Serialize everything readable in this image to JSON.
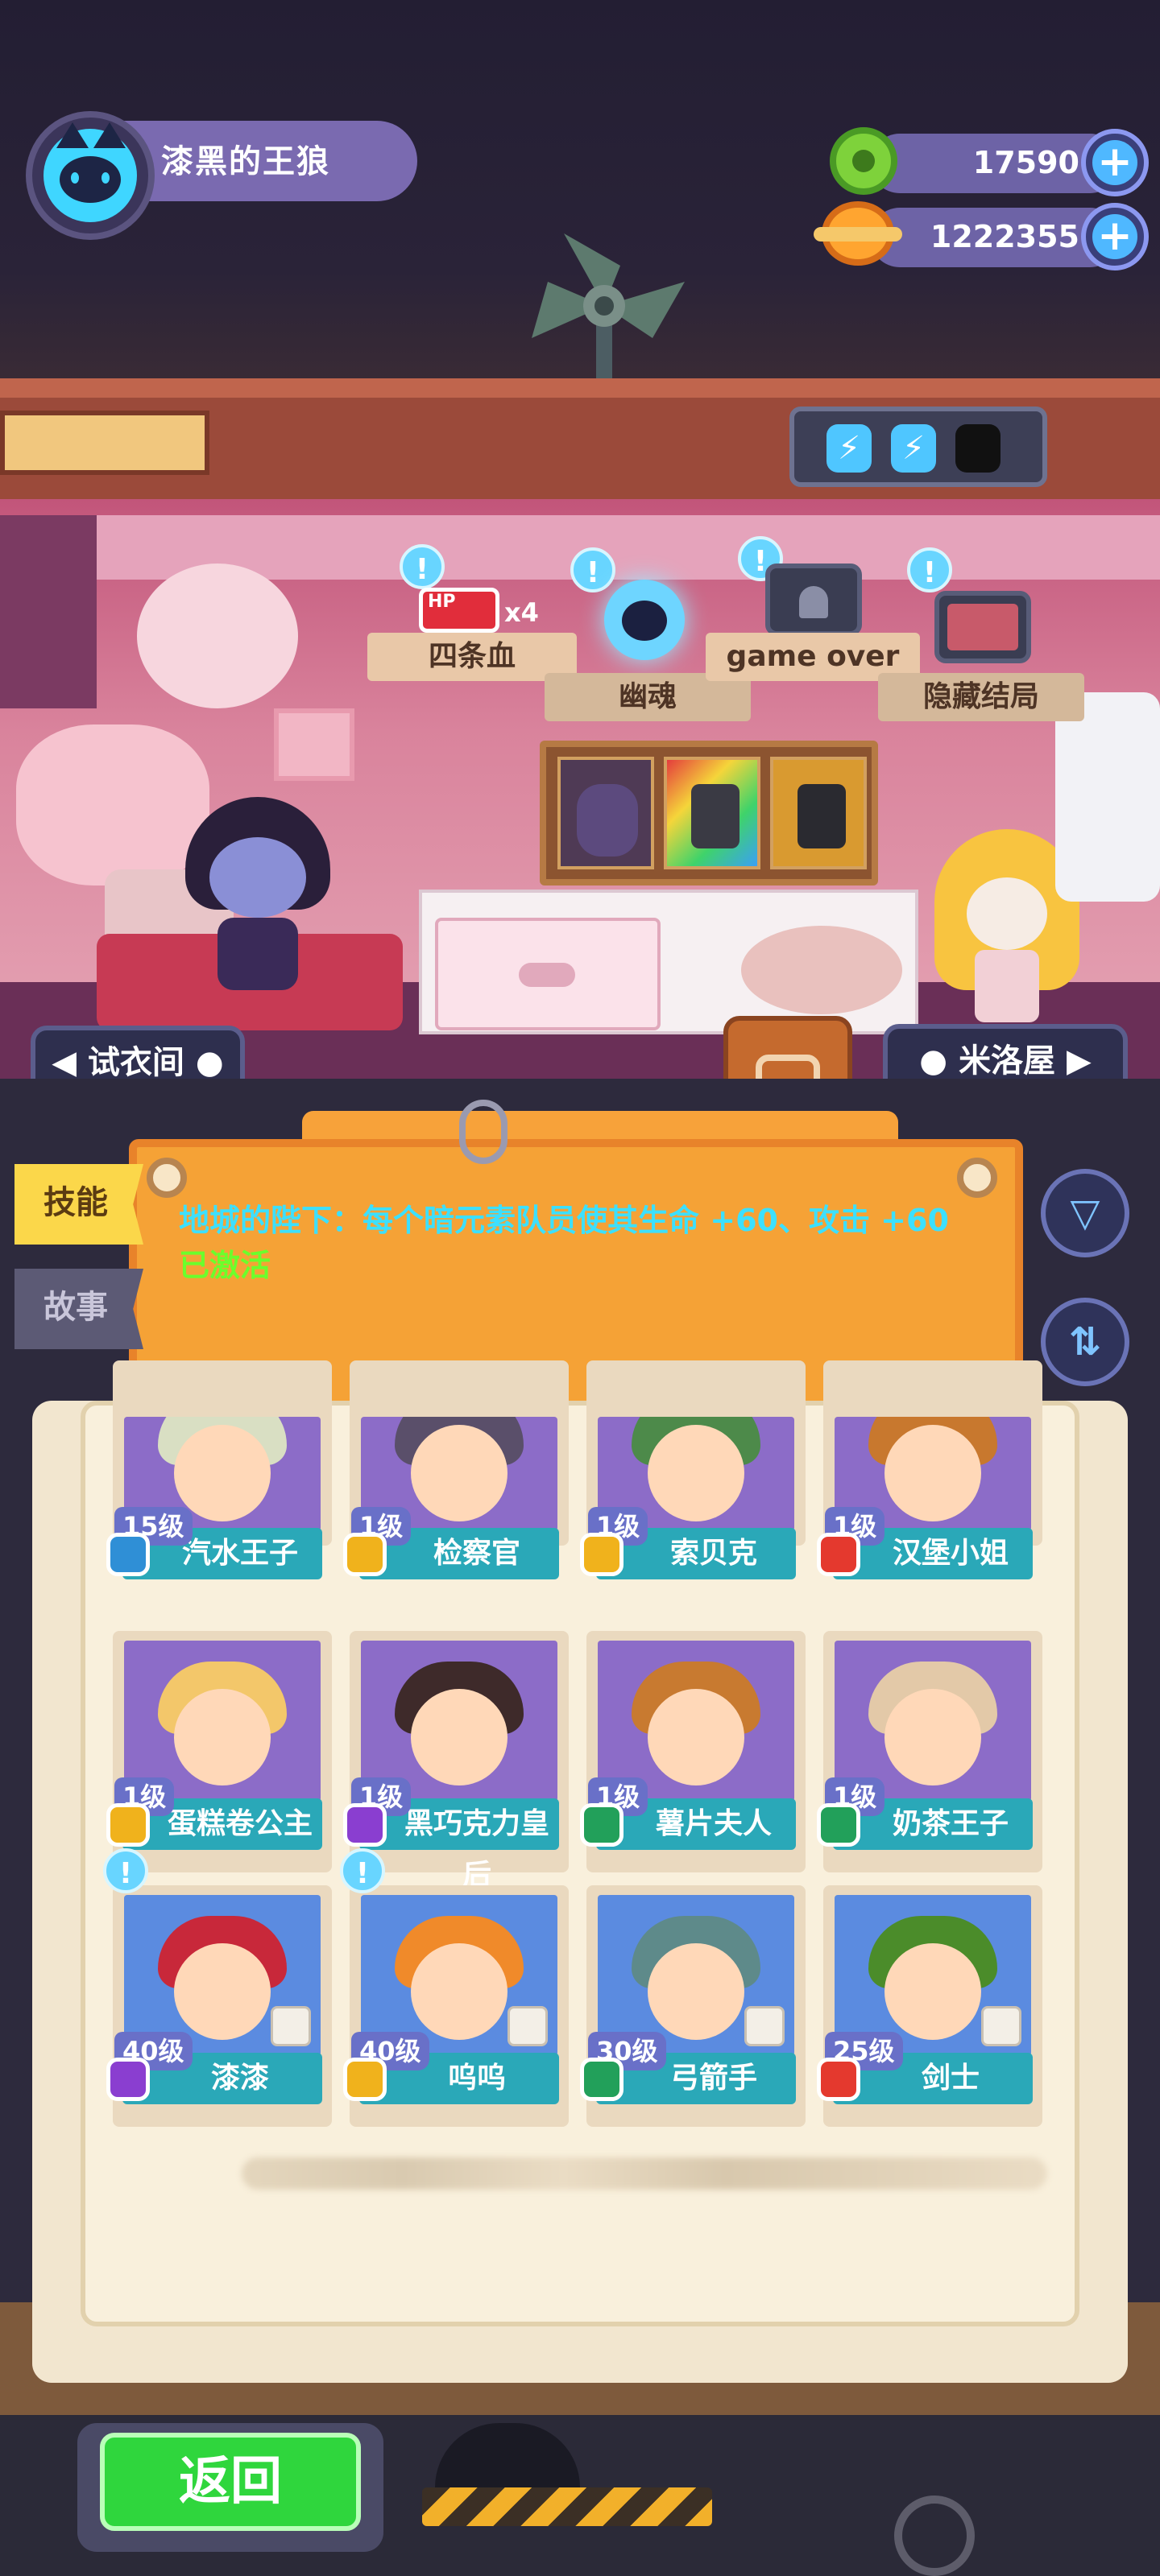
{
  "player": {
    "name": "漆黑的王狼",
    "avatar_icon": "black-cat-avatar-icon"
  },
  "currencies": [
    {
      "name": "green-coin",
      "value": "17590",
      "icon": "green-donut-coin-icon"
    },
    {
      "name": "orange-planet",
      "value": "1222355",
      "icon": "orange-planet-icon"
    }
  ],
  "energy": {
    "charged": 2,
    "slots": 3
  },
  "endings": [
    {
      "label": "四条血",
      "badge": "HP",
      "count": "x4"
    },
    {
      "label": "幽魂"
    },
    {
      "label": "game over"
    },
    {
      "label": "隐藏结局"
    }
  ],
  "nav": {
    "left": "试衣间",
    "right": "米洛屋"
  },
  "tabs": {
    "skill": "技能",
    "story": "故事"
  },
  "skill_panel": {
    "text": "地城的陛下：每个暗元素队员使其生命 +60、攻击 +60",
    "status": "已激活"
  },
  "cards": [
    {
      "level": "15级",
      "name": "汽水王子",
      "class_color": "#2f8fd6",
      "portrait": "#8c6cc8",
      "hair": "#d9dfc3"
    },
    {
      "level": "1级",
      "name": "检察官",
      "class_color": "#f0b21c",
      "portrait": "#8c6cc8",
      "hair": "#5a4f6a"
    },
    {
      "level": "1级",
      "name": "索贝克",
      "class_color": "#f0b21c",
      "portrait": "#8c6cc8",
      "hair": "#4d8a4a"
    },
    {
      "level": "1级",
      "name": "汉堡小姐",
      "class_color": "#e4392e",
      "portrait": "#8c6cc8",
      "hair": "#c8782e"
    },
    {
      "level": "1级",
      "name": "蛋糕卷公主",
      "class_color": "#f0b21c",
      "portrait": "#8c6cc8",
      "hair": "#f3c76a"
    },
    {
      "level": "1级",
      "name": "黑巧克力皇后",
      "class_color": "#8a3ed0",
      "portrait": "#8c6cc8",
      "hair": "#3e2a2a"
    },
    {
      "level": "1级",
      "name": "薯片夫人",
      "class_color": "#22a05a",
      "portrait": "#8c6cc8",
      "hair": "#c87a30"
    },
    {
      "level": "1级",
      "name": "奶茶王子",
      "class_color": "#22a05a",
      "portrait": "#8c6cc8",
      "hair": "#e3c9a8"
    },
    {
      "level": "40级",
      "name": "漆漆",
      "class_color": "#8a3ed0",
      "portrait": "#5b8be0",
      "hair": "#c8283a",
      "alert": true
    },
    {
      "level": "40级",
      "name": "呜呜",
      "class_color": "#f0b21c",
      "portrait": "#5b8be0",
      "hair": "#f08a2a",
      "alert": true
    },
    {
      "level": "30级",
      "name": "弓箭手",
      "class_color": "#22a05a",
      "portrait": "#5b8be0",
      "hair": "#5e8a8a"
    },
    {
      "level": "25级",
      "name": "剑士",
      "class_color": "#e4392e",
      "portrait": "#5b8be0",
      "hair": "#4b8c2a"
    }
  ],
  "buttons": {
    "back": "返回",
    "filter_icon": "filter-icon",
    "sort_icon": "sort-icon"
  }
}
